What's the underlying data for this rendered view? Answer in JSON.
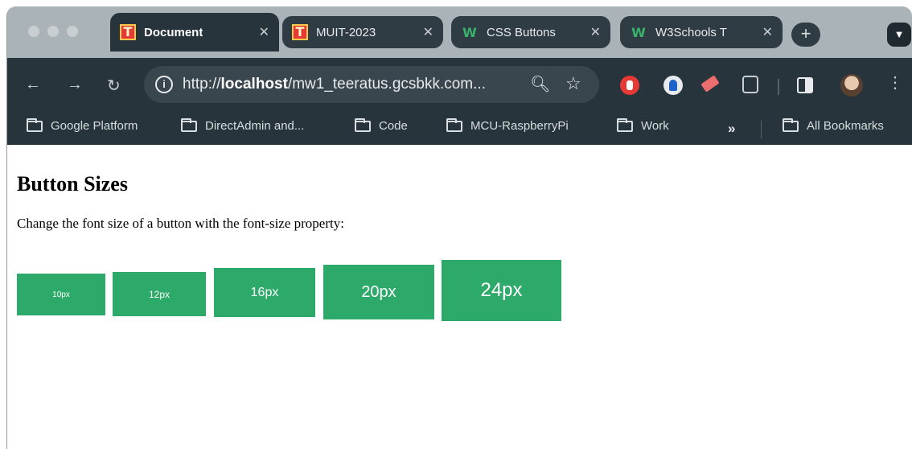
{
  "tabs": [
    {
      "title": "Document",
      "favicon": "t-icon",
      "active": true
    },
    {
      "title": "MUIT-2023",
      "favicon": "t-icon",
      "active": false
    },
    {
      "title": "CSS Buttons",
      "favicon": "w3schools-icon",
      "active": false
    },
    {
      "title": "W3Schools T",
      "favicon": "w3schools-icon",
      "active": false
    }
  ],
  "toolbar": {
    "url_prefix": "http://",
    "url_host": "localhost",
    "url_path": "/mw1_teeratus.gcsbkk.com..."
  },
  "bookmarks": [
    "Google Platform",
    "DirectAdmin and...",
    "Code",
    "MCU-RaspberryPi",
    "Work"
  ],
  "all_bookmarks": "All Bookmarks",
  "page": {
    "heading": "Button Sizes",
    "description": "Change the font size of a button with the font-size property:",
    "buttons": [
      "10px",
      "12px",
      "16px",
      "20px",
      "24px"
    ]
  },
  "colors": {
    "button_bg": "#2daa6a",
    "chrome_dark": "#27343b",
    "tabstrip": "#a9b3b8"
  }
}
